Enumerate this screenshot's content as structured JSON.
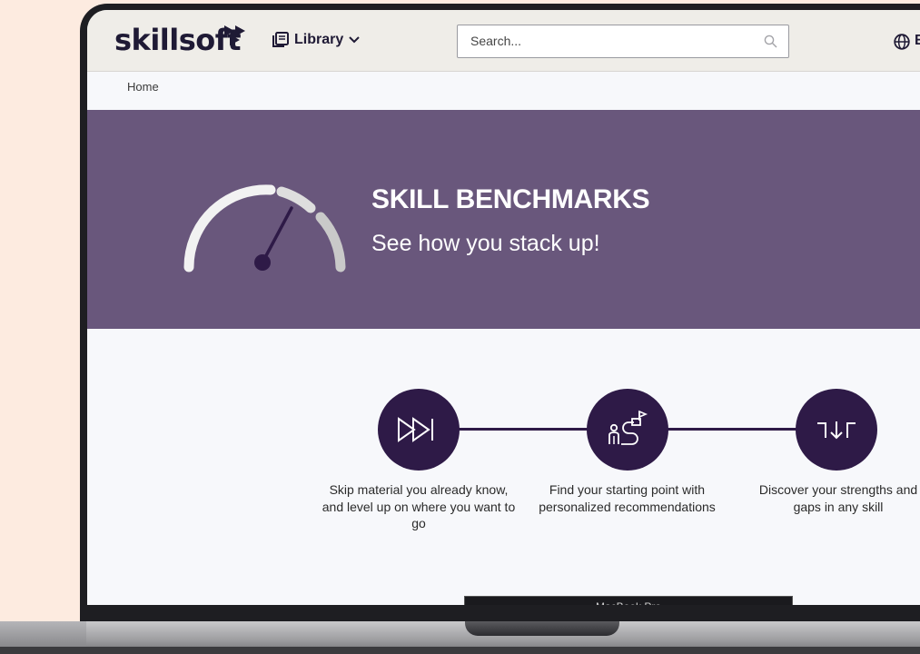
{
  "header": {
    "logo_text": "skillsoft",
    "library_label": "Library",
    "search_placeholder": "Search...",
    "language_label": "E"
  },
  "breadcrumb": {
    "home": "Home"
  },
  "hero": {
    "title": "SKILL BENCHMARKS",
    "subtitle": "See how you stack up!"
  },
  "steps": [
    {
      "icon": "skip-forward-icon",
      "text": "Skip material you already know, and level up on where you want to go"
    },
    {
      "icon": "starting-point-icon",
      "text": "Find your starting point with personalized recommendations"
    },
    {
      "icon": "strengths-gaps-icon",
      "text": "Discover your strengths and gaps in any skill"
    }
  ],
  "device": {
    "label": "MacBook Pro"
  },
  "colors": {
    "page_background": "#fdebe0",
    "hero_background": "#69577c",
    "step_circle": "#2e1a47",
    "topbar": "#efede8"
  }
}
